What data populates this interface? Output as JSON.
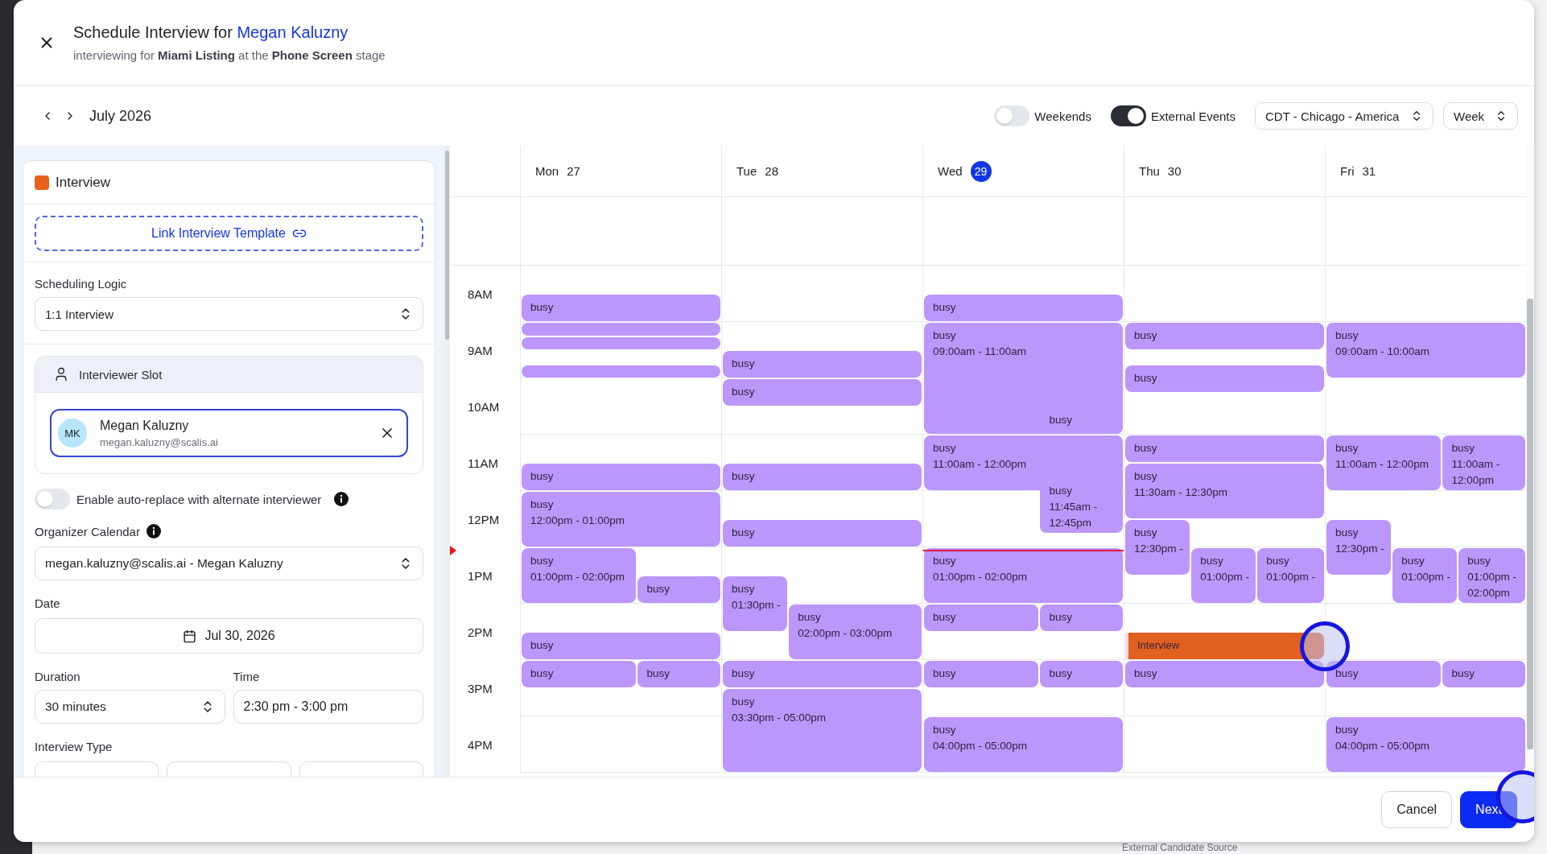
{
  "header": {
    "title": "Schedule Interview for",
    "candidate": "Megan Kaluzny",
    "subtitle": "interviewing for **Miami Listing** at the **Phone Screen** stage"
  },
  "toolbar": {
    "period": "July 2026",
    "toggles": [
      {
        "label": "Weekends",
        "on": false
      },
      {
        "label": "External Events",
        "on": true
      }
    ],
    "timezone": "CDT - Chicago - America",
    "view": "Week"
  },
  "form": {
    "title": "Interview",
    "template_link": "Link Interview Template",
    "scheduling_logic": {
      "label": "Scheduling Logic",
      "value": "1:1 Interview"
    },
    "interviewer_slot": {
      "title": "Interviewer Slot",
      "interviewer": {
        "initials": "MK",
        "name": "Megan Kaluzny",
        "email": "megan.kaluzny@scalis.ai"
      }
    },
    "auto_replace": {
      "label": "Enable auto-replace with alternate interviewer",
      "on": false
    },
    "organizer": {
      "label": "Organizer Calendar",
      "value": "megan.kaluzny@scalis.ai - Megan Kaluzny"
    },
    "date": {
      "label": "Date",
      "value": "Jul 30, 2026"
    },
    "duration": {
      "label": "Duration",
      "value": "30 minutes"
    },
    "time": {
      "label": "Time",
      "value": "2:30 pm - 3:00 pm"
    },
    "interview_type": {
      "label": "Interview Type"
    }
  },
  "calendar": {
    "hours": [
      "8AM",
      "9AM",
      "10AM",
      "11AM",
      "12PM",
      "1PM",
      "2PM",
      "3PM",
      "4PM"
    ],
    "days": [
      {
        "name": "Mon",
        "date": "27",
        "today": false,
        "events": [
          {
            "kind": "busy",
            "title": "busy"
          },
          {
            "kind": "busy"
          },
          {
            "kind": "busy"
          },
          {
            "kind": "busy"
          },
          {
            "kind": "busy",
            "title": "busy"
          },
          {
            "kind": "busy",
            "title": "busy",
            "time": "12:00pm - 01:00pm"
          },
          {
            "kind": "busy",
            "title": "busy",
            "time": "01:00pm - 02:00pm"
          },
          {
            "kind": "busy",
            "title": "busy"
          },
          {
            "kind": "busy",
            "title": "busy"
          },
          {
            "kind": "busy",
            "title": "busy"
          },
          {
            "kind": "busy",
            "title": "busy"
          }
        ]
      },
      {
        "name": "Tue",
        "date": "28",
        "today": false,
        "events": [
          {
            "kind": "busy",
            "title": "busy"
          },
          {
            "kind": "busy",
            "title": "busy"
          },
          {
            "kind": "busy",
            "title": "busy"
          },
          {
            "kind": "busy",
            "title": "busy"
          },
          {
            "kind": "busy",
            "title": "busy",
            "time": "01:30pm -"
          },
          {
            "kind": "busy",
            "title": "busy",
            "time": "02:00pm - 03:00pm"
          },
          {
            "kind": "busy",
            "title": "busy"
          },
          {
            "kind": "busy",
            "title": "busy",
            "time": "03:30pm - 05:00pm"
          }
        ]
      },
      {
        "name": "Wed",
        "date": "29",
        "today": true,
        "events": [
          {
            "kind": "busy",
            "title": "busy"
          },
          {
            "kind": "busy",
            "title": "busy",
            "time": "09:00am - 11:00am"
          },
          {
            "kind": "busy",
            "title": "busy"
          },
          {
            "kind": "busy",
            "title": "busy",
            "time": "11:00am - 12:00pm"
          },
          {
            "kind": "busy",
            "title": "busy",
            "time": "11:45am - 12:45pm"
          },
          {
            "kind": "busy",
            "title": "busy",
            "time": "01:00pm - 02:00pm"
          },
          {
            "kind": "busy",
            "title": "busy"
          },
          {
            "kind": "busy",
            "title": "busy"
          },
          {
            "kind": "busy",
            "title": "busy"
          },
          {
            "kind": "busy",
            "title": "busy"
          },
          {
            "kind": "busy",
            "title": "busy",
            "time": "04:00pm - 05:00pm"
          }
        ]
      },
      {
        "name": "Thu",
        "date": "30",
        "today": false,
        "events": [
          {
            "kind": "busy",
            "title": "busy"
          },
          {
            "kind": "busy",
            "title": "busy"
          },
          {
            "kind": "busy",
            "title": "busy"
          },
          {
            "kind": "busy",
            "title": "busy",
            "time": "11:30am - 12:30pm"
          },
          {
            "kind": "busy",
            "title": "busy",
            "time": "12:30pm -"
          },
          {
            "kind": "busy",
            "title": "busy",
            "time": "01:00pm -"
          },
          {
            "kind": "busy",
            "title": "busy",
            "time": "01:00pm -"
          },
          {
            "kind": "interview",
            "title": "Interview"
          },
          {
            "kind": "busy",
            "title": "busy"
          }
        ]
      },
      {
        "name": "Fri",
        "date": "31",
        "today": false,
        "events": [
          {
            "kind": "busy",
            "title": "busy",
            "time": "09:00am - 10:00am"
          },
          {
            "kind": "busy",
            "title": "busy",
            "time": "11:00am - 12:00pm"
          },
          {
            "kind": "busy",
            "title": "busy",
            "time": "11:00am - 12:00pm"
          },
          {
            "kind": "busy",
            "title": "busy",
            "time": "12:30pm -"
          },
          {
            "kind": "busy",
            "title": "busy",
            "time": "01:00pm -"
          },
          {
            "kind": "busy",
            "title": "busy",
            "time": "01:00pm - 02:00pm"
          },
          {
            "kind": "busy",
            "title": "busy"
          },
          {
            "kind": "busy",
            "title": "busy"
          },
          {
            "kind": "busy",
            "title": "busy",
            "time": "04:00pm - 05:00pm"
          }
        ]
      }
    ]
  },
  "footer": {
    "buttons": [
      {
        "label": "Cancel",
        "kind": "secondary"
      },
      {
        "label": "Next",
        "kind": "primary"
      }
    ]
  },
  "backdrop": {
    "text": "External Candidate Source"
  }
}
